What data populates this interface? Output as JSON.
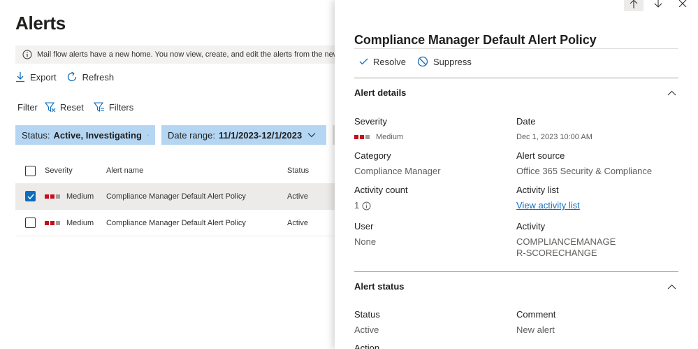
{
  "page": {
    "title": "Alerts"
  },
  "banner": {
    "text": "Mail flow alerts have a new home. You now view, create, and edit the alerts from the new Ex"
  },
  "commands": {
    "export": "Export",
    "refresh": "Refresh"
  },
  "filter": {
    "label": "Filter",
    "reset": "Reset",
    "filters": "Filters"
  },
  "chips": {
    "status_label": "Status:",
    "status_value": "Active, Investigating",
    "date_label": "Date range:",
    "date_value": "11/1/2023-12/1/2023"
  },
  "table": {
    "headers": {
      "severity": "Severity",
      "name": "Alert name",
      "status": "Status"
    },
    "rows": [
      {
        "severity": "Medium",
        "name": "Compliance Manager Default Alert Policy",
        "status": "Active",
        "selected": true
      },
      {
        "severity": "Medium",
        "name": "Compliance Manager Default Alert Policy",
        "status": "Active",
        "selected": false
      }
    ]
  },
  "panel": {
    "title": "Compliance Manager Default Alert Policy",
    "actions": {
      "resolve": "Resolve",
      "suppress": "Suppress"
    },
    "details": {
      "heading": "Alert details",
      "severity_label": "Severity",
      "severity_value": "Medium",
      "date_label": "Date",
      "date_value": "Dec 1, 2023 10:00 AM",
      "category_label": "Category",
      "category_value": "Compliance Manager",
      "source_label": "Alert source",
      "source_value": "Office 365 Security & Compliance",
      "count_label": "Activity count",
      "count_value": "1",
      "list_label": "Activity list",
      "list_link": "View activity list",
      "user_label": "User",
      "user_value": "None",
      "activity_label": "Activity",
      "activity_value": "COMPLIANCEMANAGER-SCORECHANGE"
    },
    "status_section": {
      "heading": "Alert status",
      "status_label": "Status",
      "status_value": "Active",
      "comment_label": "Comment",
      "comment_value": "New alert",
      "action_label": "Action"
    }
  },
  "colors": {
    "severity_red": "#c50f1f",
    "severity_grey": "#a19f9d",
    "chip_bg": "#b4d6f3",
    "accent": "#0f6cbd",
    "selected_row": "#edebe9"
  },
  "icons": [
    "info-icon",
    "download-icon",
    "refresh-icon",
    "filter-reset-icon",
    "filter-icon",
    "close-icon",
    "chevron-down-icon",
    "checkmark-icon",
    "arrow-up-icon",
    "arrow-down-icon",
    "block-icon",
    "chevron-up-icon",
    "info-circle-icon"
  ]
}
